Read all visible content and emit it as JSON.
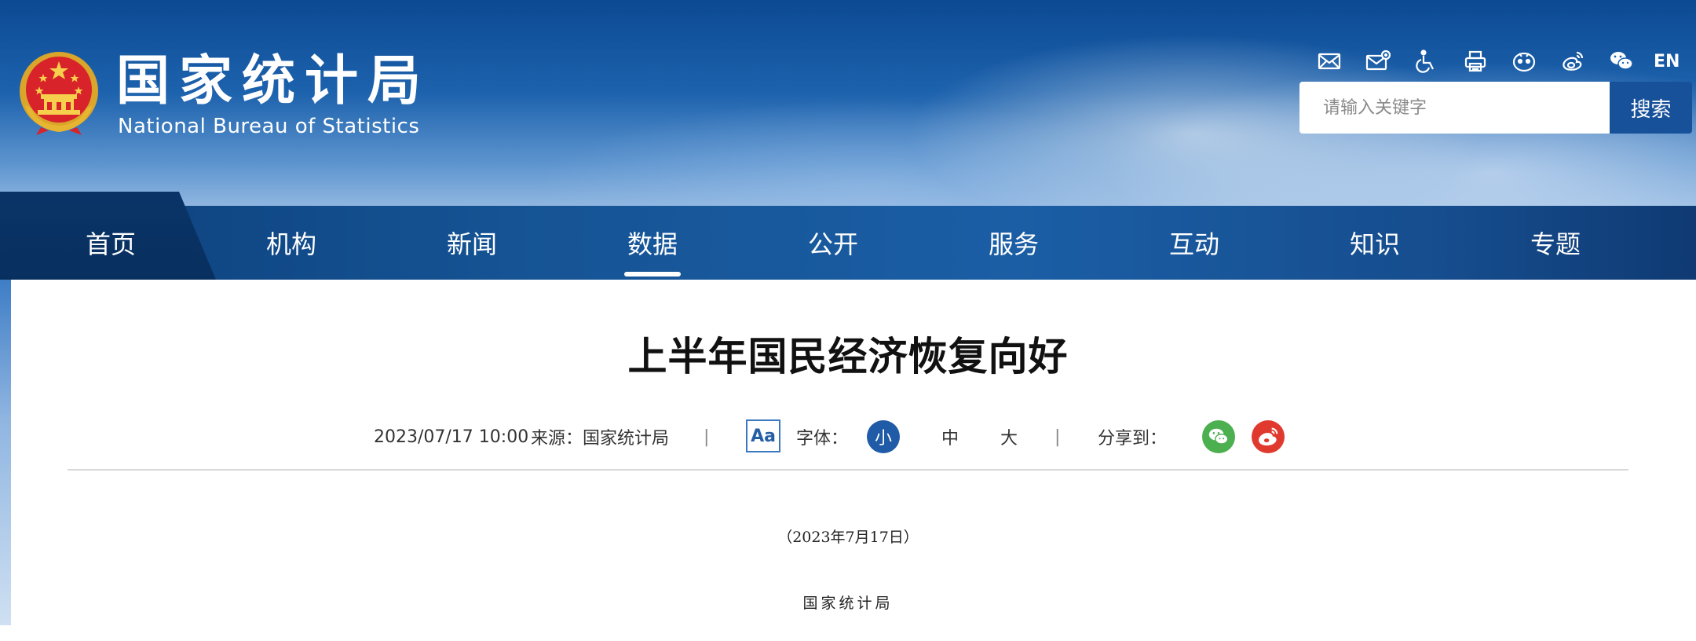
{
  "header": {
    "site_name_cn": "国家统计局",
    "site_name_en": "National Bureau of Statistics",
    "tools": [
      "mail-icon",
      "feedback-mail-icon",
      "accessibility-icon",
      "print-icon",
      "mini-program-icon",
      "weibo-icon",
      "wechat-icon"
    ],
    "lang_label": "EN",
    "search": {
      "placeholder": "请输入关键字",
      "button_label": "搜索"
    }
  },
  "nav": {
    "items": [
      {
        "label": "首页"
      },
      {
        "label": "机构"
      },
      {
        "label": "新闻"
      },
      {
        "label": "数据",
        "active": true
      },
      {
        "label": "公开"
      },
      {
        "label": "服务"
      },
      {
        "label": "互动"
      },
      {
        "label": "知识"
      },
      {
        "label": "专题"
      }
    ]
  },
  "article": {
    "title": "上半年国民经济恢复向好",
    "datetime": "2023/07/17 10:00",
    "source_label": "来源：国家统计局",
    "separator": "|",
    "font_icon_label": "Aa",
    "font_label": "字体：",
    "font_sizes": [
      "小",
      "中",
      "大"
    ],
    "share_label": "分享到：",
    "share_icons": [
      "wechat-icon",
      "weibo-icon"
    ],
    "date_line": "（2023年7月17日）",
    "author_line": "国家统计局"
  },
  "colors": {
    "header_blue": "#0c4a93",
    "nav_blue": "#155394",
    "accent_blue": "#1f5ba6",
    "wechat_green": "#4caf50",
    "weibo_red": "#e03a2f"
  }
}
